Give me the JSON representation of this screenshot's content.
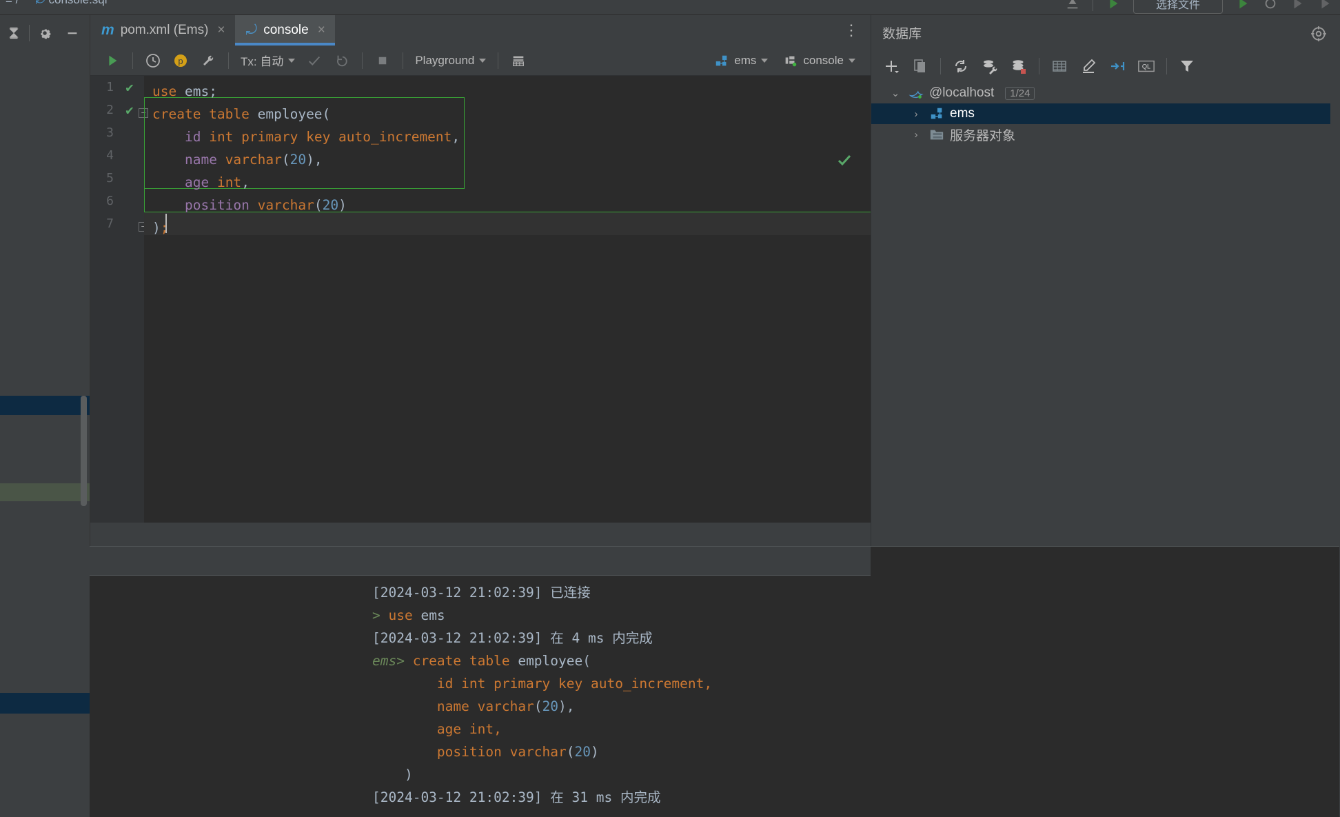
{
  "breadcrumb": {
    "prefix": "≡ /",
    "file": "console.sql"
  },
  "top_strip": {
    "boxed_label": "选择文件",
    "icons": [
      "upload-icon",
      "run-green-icon",
      "debug-icon",
      "stop-icon",
      "more-icon"
    ]
  },
  "left_tools": {
    "items": [
      {
        "name": "collapse-all-button",
        "icon": "collapse-all-icon"
      },
      {
        "name": "settings-button",
        "icon": "gear-icon"
      },
      {
        "name": "hide-panel-button",
        "icon": "minimize-icon"
      }
    ]
  },
  "tabs": [
    {
      "label": "pom.xml (Ems)",
      "icon": "maven-m-icon",
      "active": false,
      "close": "×"
    },
    {
      "label": "console",
      "icon": "mysql-dolphin-icon",
      "active": true,
      "close": "×"
    }
  ],
  "tabbar": {
    "more_label": "⋮"
  },
  "editor_toolbar": {
    "run_label": "run-button",
    "history_label": "history-button",
    "profile_label": "p-profile-button",
    "wrench_label": "wrench-button",
    "tx_label": "Tx: 自动",
    "commit_label": "commit-button",
    "rollback_label": "rollback-button",
    "stop_label": "stop-button",
    "schema_label": "Playground",
    "grid_label": "table-view-button",
    "datasource_label": "ems",
    "session_label": "console"
  },
  "editor": {
    "lines": [
      {
        "n": "1",
        "status": "check",
        "fold": false,
        "tokens": [
          {
            "t": "use ",
            "c": "k"
          },
          {
            "t": "ems",
            "c": "pl"
          },
          {
            "t": ";",
            "c": "pl"
          }
        ]
      },
      {
        "n": "2",
        "status": "check",
        "fold": true,
        "tokens": [
          {
            "t": "create table ",
            "c": "k"
          },
          {
            "t": "employee",
            "c": "pl"
          },
          {
            "t": "(",
            "c": "pl"
          }
        ]
      },
      {
        "n": "3",
        "status": "",
        "fold": false,
        "tokens": [
          {
            "t": "    ",
            "c": "pl"
          },
          {
            "t": "id",
            "c": "id"
          },
          {
            "t": " ",
            "c": "pl"
          },
          {
            "t": "int primary key auto_increment",
            "c": "k"
          },
          {
            "t": ",",
            "c": "pl"
          }
        ]
      },
      {
        "n": "4",
        "status": "",
        "fold": false,
        "tokens": [
          {
            "t": "    ",
            "c": "pl"
          },
          {
            "t": "name",
            "c": "id"
          },
          {
            "t": " ",
            "c": "pl"
          },
          {
            "t": "varchar",
            "c": "k"
          },
          {
            "t": "(",
            "c": "pl"
          },
          {
            "t": "20",
            "c": "num"
          },
          {
            "t": ")",
            "c": "pl"
          },
          {
            "t": ",",
            "c": "pl"
          }
        ]
      },
      {
        "n": "5",
        "status": "",
        "fold": false,
        "tokens": [
          {
            "t": "    ",
            "c": "pl"
          },
          {
            "t": "age",
            "c": "id"
          },
          {
            "t": " ",
            "c": "pl"
          },
          {
            "t": "int",
            "c": "k"
          },
          {
            "t": ",",
            "c": "pl"
          }
        ]
      },
      {
        "n": "6",
        "status": "",
        "fold": false,
        "tokens": [
          {
            "t": "    ",
            "c": "pl"
          },
          {
            "t": "position",
            "c": "id"
          },
          {
            "t": " ",
            "c": "pl"
          },
          {
            "t": "varchar",
            "c": "k"
          },
          {
            "t": "(",
            "c": "pl"
          },
          {
            "t": "20",
            "c": "num"
          },
          {
            "t": ")",
            "c": "pl"
          }
        ]
      },
      {
        "n": "7",
        "status": "",
        "fold": "end",
        "tokens": [
          {
            "t": ")",
            "c": "pl"
          },
          {
            "t": ";",
            "c": "k"
          }
        ]
      }
    ],
    "inspection_status": "check"
  },
  "console_output": {
    "lines": [
      [
        {
          "t": "[2024-03-12 21:02:39] ",
          "c": "c-ts"
        },
        {
          "t": "已连接",
          "c": "c-ts"
        }
      ],
      [
        {
          "t": "> ",
          "c": "c-prompt"
        },
        {
          "t": "use ",
          "c": "c-sql"
        },
        {
          "t": "ems",
          "c": "c-ts"
        }
      ],
      [
        {
          "t": "[2024-03-12 21:02:39] ",
          "c": "c-ts"
        },
        {
          "t": "在 4 ms 内完成",
          "c": "c-ts"
        }
      ],
      [
        {
          "t": "ems> ",
          "c": "c-promptem"
        },
        {
          "t": "create table ",
          "c": "c-sql"
        },
        {
          "t": "employee(",
          "c": "c-ts"
        }
      ],
      [
        {
          "t": "        ",
          "c": "c-ts"
        },
        {
          "t": "id int primary key auto_increment,",
          "c": "c-sql"
        }
      ],
      [
        {
          "t": "        ",
          "c": "c-ts"
        },
        {
          "t": "name varchar",
          "c": "c-sql"
        },
        {
          "t": "(",
          "c": "c-ts"
        },
        {
          "t": "20",
          "c": "c-num"
        },
        {
          "t": "),",
          "c": "c-ts"
        }
      ],
      [
        {
          "t": "        ",
          "c": "c-ts"
        },
        {
          "t": "age int,",
          "c": "c-sql"
        }
      ],
      [
        {
          "t": "        ",
          "c": "c-ts"
        },
        {
          "t": "position varchar",
          "c": "c-sql"
        },
        {
          "t": "(",
          "c": "c-ts"
        },
        {
          "t": "20",
          "c": "c-num"
        },
        {
          "t": ")",
          "c": "c-ts"
        }
      ],
      [
        {
          "t": "    )",
          "c": "c-ts"
        }
      ],
      [
        {
          "t": "[2024-03-12 21:02:39] ",
          "c": "c-ts"
        },
        {
          "t": "在 31 ms 内完成",
          "c": "c-ts"
        }
      ]
    ]
  },
  "database_panel": {
    "title": "数据库",
    "settings_icon": "target-settings-icon",
    "toolbar": [
      {
        "name": "add-button",
        "icon": "plus-icon"
      },
      {
        "name": "duplicate-button",
        "icon": "copy-icon"
      },
      {
        "name": "refresh-button",
        "icon": "refresh-icon"
      },
      {
        "name": "datasource-properties-button",
        "icon": "db-wrench-icon"
      },
      {
        "name": "disconnect-button",
        "icon": "db-stop-icon"
      },
      {
        "name": "open-table-button",
        "icon": "table-icon"
      },
      {
        "name": "modify-button",
        "icon": "pencil-icon"
      },
      {
        "name": "collapse-button",
        "icon": "collapse-arrows-icon"
      },
      {
        "name": "jump-to-query-button",
        "icon": "ql-icon"
      },
      {
        "name": "filter-button",
        "icon": "filter-icon"
      }
    ],
    "tree": [
      {
        "label": "@localhost",
        "icon": "mysql-dolphin-icon",
        "indent": 0,
        "expanded": true,
        "badge": "1/24",
        "selected": false
      },
      {
        "label": "ems",
        "icon": "schema-icon",
        "indent": 1,
        "expanded": false,
        "badge": "",
        "selected": true
      },
      {
        "label": "服务器对象",
        "icon": "folder-icon",
        "indent": 1,
        "expanded": false,
        "badge": "",
        "selected": false
      }
    ]
  },
  "colors": {
    "accent": "#4a88c7",
    "selection": "#0d293f",
    "keyword": "#cc7832",
    "identifier": "#9876aa",
    "number": "#6897bb",
    "success": "#59a869",
    "prompt": "#6a8759"
  }
}
